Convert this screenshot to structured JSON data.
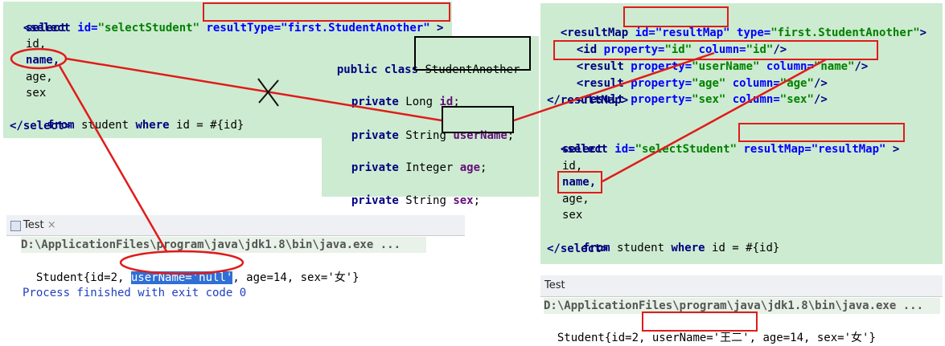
{
  "left_code": {
    "lines": [
      [
        "<select ",
        "id=",
        "\"selectStudent\"",
        " ",
        "resultType=\"first.StudentAnother\"",
        " >"
      ],
      "select",
      "id,",
      "name,",
      "age,",
      "sex",
      [
        "from",
        " student ",
        "where",
        " id = #{id}"
      ],
      "</select>"
    ]
  },
  "java_class": {
    "decl": [
      "public class",
      "StudentAnother"
    ],
    "fields": [
      [
        "private",
        " Long ",
        "id",
        ";"
      ],
      [
        "private",
        " String ",
        "userName",
        ";"
      ],
      [
        "private",
        " Integer ",
        "age",
        ";"
      ],
      [
        "private",
        " String ",
        "sex",
        ";"
      ]
    ]
  },
  "right_code": {
    "result_map": [
      [
        "<resultMap ",
        "id=\"resultMap\"",
        " ",
        "type=",
        "\"first.StudentAnother\"",
        ">"
      ],
      [
        "<id ",
        "property=",
        "\"id\"",
        " ",
        "column=",
        "\"id\"",
        "/>"
      ],
      [
        "<result ",
        "property=",
        "\"userName\"",
        " ",
        "column=",
        "\"name\"",
        "/>"
      ],
      [
        "<result ",
        "property=",
        "\"age\"",
        " ",
        "column=",
        "\"age\"",
        "/>"
      ],
      [
        "<result ",
        "property=",
        "\"sex\"",
        " ",
        "column=",
        "\"sex\"",
        "/>"
      ],
      "</resultMap>"
    ],
    "select": [
      [
        "<select ",
        "id=",
        "\"selectStudent\"",
        " ",
        "resultMap=\"resultMap\"",
        " >"
      ],
      "select",
      "id,",
      "name,",
      "age,",
      "sex",
      [
        "from",
        " student ",
        "where",
        " id = #{id}"
      ],
      "</select>"
    ]
  },
  "console_left": {
    "tab": "Test",
    "tab_close": "×",
    "cmd": "D:\\ApplicationFiles\\program\\java\\jdk1.8\\bin\\java.exe ...",
    "out_pre": "Student{id=2, ",
    "out_hl": "userName='null'",
    "out_post": ", age=14, sex='女'}",
    "process": "Process finished with exit code 0"
  },
  "console_right": {
    "tab": "Test",
    "cmd": "D:\\ApplicationFiles\\program\\java\\jdk1.8\\bin\\java.exe ...",
    "out_pre": "Student{id=2, ",
    "out_hl": "userName='王二'",
    "out_post": ", age=14, sex='女'}"
  },
  "colors": {
    "panel": "#cdebd0",
    "highlight": "#e01b1b",
    "selection": "#2f6fd6"
  }
}
